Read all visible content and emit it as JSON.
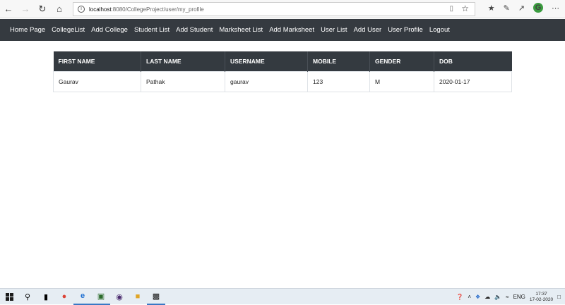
{
  "browser": {
    "url_host": "localhost",
    "url_path": ":8080/CollegeProject/user/my_profile"
  },
  "nav": {
    "items": [
      "Home Page",
      "CollegeList",
      "Add College",
      "Student List",
      "Add Student",
      "Marksheet List",
      "Add Marksheet",
      "User List",
      "Add User",
      "User Profile",
      "Logout"
    ]
  },
  "profile_table": {
    "headers": [
      "FIRST NAME",
      "LAST NAME",
      "USERNAME",
      "MOBILE",
      "GENDER",
      "DOB"
    ],
    "row": [
      "Gaurav",
      "Pathak",
      "gaurav",
      "123",
      "M",
      "2020-01-17"
    ]
  },
  "taskbar": {
    "language": "ENG",
    "time": "17:37",
    "date": "17-02-2020"
  },
  "icons": {
    "back": "back-arrow-icon",
    "forward": "forward-arrow-icon",
    "refresh": "refresh-icon",
    "home": "home-icon",
    "favorite": "star-icon"
  }
}
